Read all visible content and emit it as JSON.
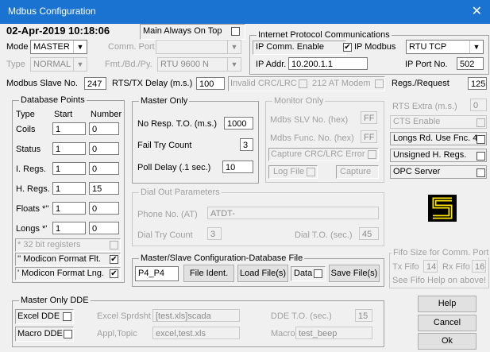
{
  "window": {
    "title": "Mdbus Configuration",
    "close_glyph": "✕"
  },
  "header": {
    "datetime": "02-Apr-2019 10:18:06",
    "main_always_on_top": "Main Always On Top",
    "mode_label": "Mode",
    "mode_value": "MASTER",
    "comm_port_label": "Comm. Port",
    "comm_port_value": "",
    "type_label": "Type",
    "type_value": "NORMAL",
    "fmt_label": "Fmt./Bd./Py.",
    "fmt_value": "RTU  9600  N"
  },
  "ip": {
    "group_label": "Internet Protocol Communications",
    "enable_label": "IP Comm. Enable",
    "enable_checked": "✔",
    "modbus_label": "IP Modbus",
    "modbus_value": "RTU TCP",
    "addr_label": "IP Addr.",
    "addr_value": "10.200.1.1",
    "port_label": "IP Port No.",
    "port_value": "502"
  },
  "row2": {
    "slave_label": "Modbus Slave No.",
    "slave_value": "247",
    "rts_label": "RTS/TX Delay (m.s.)",
    "rts_value": "100",
    "invalid_crc": "Invalid CRC/LRC",
    "at_modem": "212 AT Modem",
    "regs_req_label": "Regs./Request",
    "regs_req_value": "125"
  },
  "database": {
    "group_label": "Database Points",
    "col_type": "Type",
    "col_start": "Start",
    "col_number": "Number",
    "rows": [
      {
        "type": "Coils",
        "start": "1",
        "number": "0"
      },
      {
        "type": "Status",
        "start": "1",
        "number": "0"
      },
      {
        "type": "I. Regs.",
        "start": "1",
        "number": "0"
      },
      {
        "type": "H. Regs.",
        "start": "1",
        "number": "15"
      },
      {
        "type": "Floats *''",
        "start": "1",
        "number": "0"
      },
      {
        "type": "Longs *'",
        "start": "1",
        "number": "0"
      }
    ],
    "bit32": "* 32 bit registers",
    "modicon_flt": "'' Modicon Format Flt.",
    "modicon_flt_checked": "✔",
    "modicon_lng": "' Modicon Format Lng.",
    "modicon_lng_checked": "✔"
  },
  "master_only": {
    "group_label": "Master Only",
    "noresp_label": "No Resp. T.O. (m.s.)",
    "noresp_value": "1000",
    "failtry_label": "Fail Try Count",
    "failtry_value": "3",
    "poll_label": "Poll Delay (.1 sec.)",
    "poll_value": "10"
  },
  "monitor": {
    "group_label": "Monitor Only",
    "slv_label": "Mdbs SLV No. (hex)",
    "slv_value": "FF",
    "func_label": "Mdbs Func. No. (hex)",
    "func_value": "FF",
    "capture_crc": "Capture CRC/LRC Error",
    "log_file": "Log File",
    "capture_btn": "Capture"
  },
  "right": {
    "rts_extra_label": "RTS Extra (m.s.)",
    "rts_extra_value": "0",
    "cts_enable": "CTS Enable",
    "longs_rd": "Longs Rd. Use Fnc. 4",
    "unsigned_h": "Unsigned H. Regs.",
    "opc_server": "OPC Server"
  },
  "dialout": {
    "group_label": "Dial Out Parameters",
    "phone_label": "Phone No. (AT)",
    "phone_value": "ATDT-",
    "try_label": "Dial Try Count",
    "try_value": "3",
    "to_label": "Dial T.O. (sec.)",
    "to_value": "45"
  },
  "msconfig": {
    "group_label": "Master/Slave Configuration-Database File",
    "file_value": "P4_P4",
    "file_ident": "File Ident.",
    "load_files": "Load File(s)",
    "data_label": "Data",
    "save_files": "Save File(s)"
  },
  "fifo": {
    "group_label": "Fifo Size for Comm. Port",
    "tx_label": "Tx Fifo",
    "tx_value": "14",
    "rx_label": "Rx Fifo",
    "rx_value": "16",
    "help_note": "See Fifo Help on above!"
  },
  "dde": {
    "group_label": "Master Only DDE",
    "excel_dde": "Excel DDE",
    "macro_dde": "Macro DDE",
    "sprdsht_label": "Excel Sprdsht",
    "sprdsht_value": "[test.xls]scada",
    "appl_label": "Appl,Topic",
    "appl_value": "excel,test.xls",
    "ddeto_label": "DDE T.O. (sec.)",
    "ddeto_value": "15",
    "macro_label": "Macro",
    "macro_value": "test_beep"
  },
  "buttons": {
    "help": "Help",
    "cancel": "Cancel",
    "ok": "Ok"
  },
  "colors": {
    "titlebar": "#1a73d0",
    "logo_yellow": "#ffe600"
  }
}
